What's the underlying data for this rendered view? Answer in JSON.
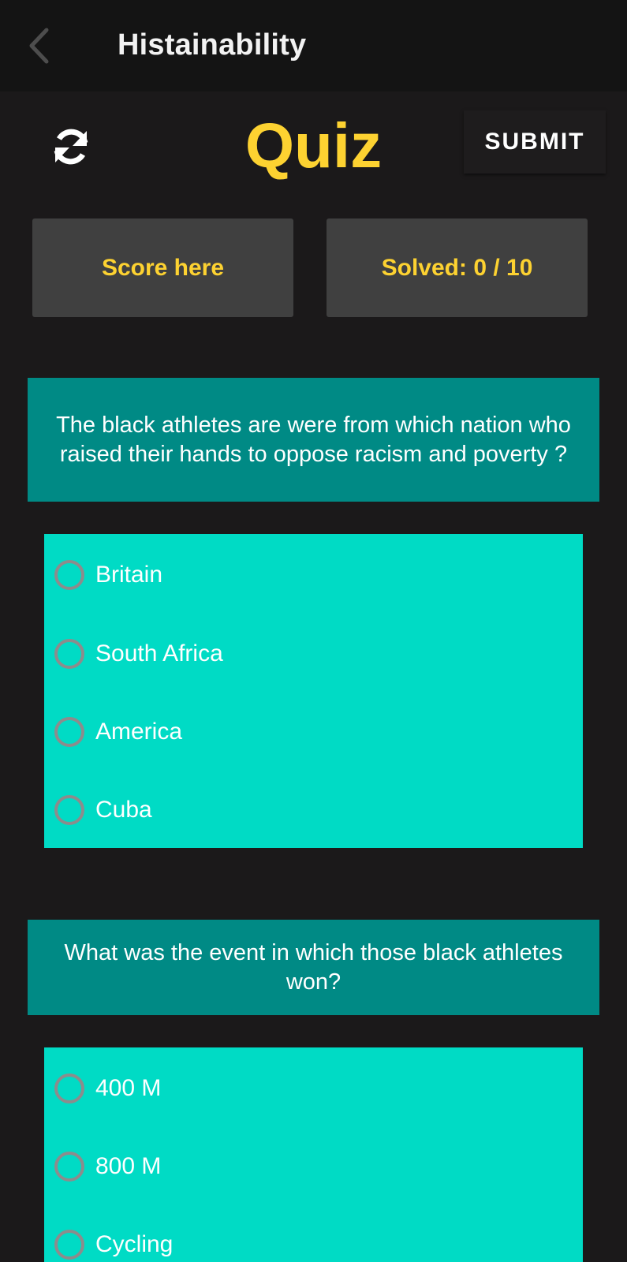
{
  "app_bar": {
    "title": "Histainability",
    "back_icon": "chevron-left-icon"
  },
  "header": {
    "refresh_icon": "refresh-icon",
    "title": "Quiz",
    "submit_label": "SUBMIT"
  },
  "stats": {
    "score_label": "Score here",
    "solved_label": "Solved: 0 / 10"
  },
  "questions": [
    {
      "text": "The black athletes are were from which nation who raised their hands to oppose racism and poverty ?",
      "options": [
        "Britain",
        "South Africa",
        "America",
        "Cuba"
      ]
    },
    {
      "text": "What was the event in which those black athletes won?",
      "options": [
        "400 M",
        "800 M",
        "Cycling"
      ]
    }
  ],
  "colors": {
    "background": "#1b191a",
    "app_bar": "#141414",
    "accent_yellow": "#fdd231",
    "stat_card": "#404040",
    "question_bg": "#008a85",
    "options_bg": "#00dbc5",
    "radio_border": "#8c8c8c"
  }
}
